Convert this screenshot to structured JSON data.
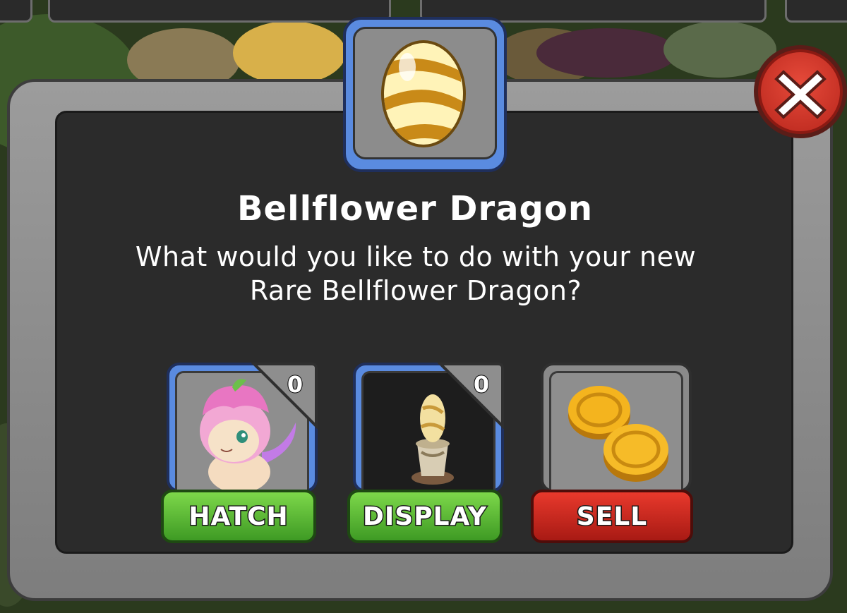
{
  "dialog": {
    "title": "Bellflower Dragon",
    "message": "What would you like to do with your new Rare Bellflower Dragon?",
    "egg_icon": "striped-golden-egg-icon",
    "close_icon": "close-x-icon"
  },
  "actions": [
    {
      "label": "HATCH",
      "count": "0",
      "icon": "pink-dragon-icon",
      "color": "#4fae2c"
    },
    {
      "label": "DISPLAY",
      "count": "0",
      "icon": "egg-pedestal-icon",
      "color": "#4fae2c"
    },
    {
      "label": "SELL",
      "icon": "gold-coins-icon",
      "color": "#d42a20"
    }
  ],
  "colors": {
    "panel_bg": "#2b2b2b",
    "frame": "#8c8c8c",
    "blue_slot": "#5a8be0",
    "green_button": "#4fae2c",
    "red_button": "#d42a20"
  }
}
